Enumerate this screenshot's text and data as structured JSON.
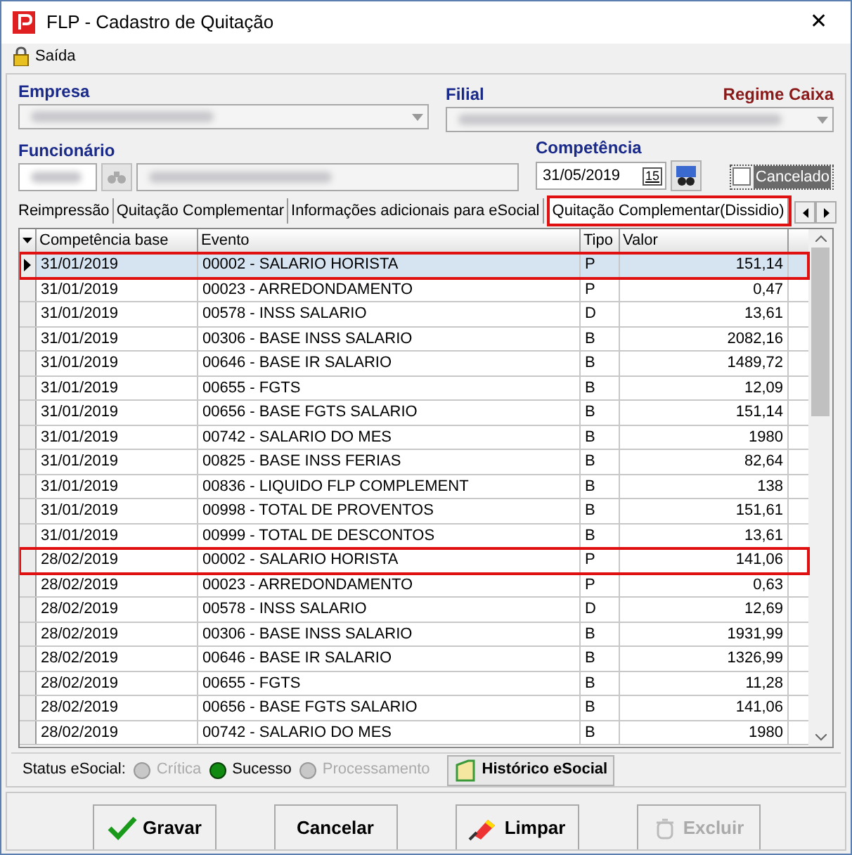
{
  "window": {
    "title": "FLP - Cadastro de Quitação",
    "close": "✕"
  },
  "menu": [
    {
      "label": "Saída"
    }
  ],
  "form": {
    "empresa_label": "Empresa",
    "filial_label": "Filial",
    "regime": "Regime Caixa",
    "funcionario_label": "Funcionário",
    "competencia_label": "Competência",
    "competencia_value": "31/05/2019",
    "calendar_day": "15",
    "cancelado": {
      "label": "Cancelado",
      "checked": false
    }
  },
  "tabs": [
    {
      "label": "Reimpressão",
      "selected": false,
      "highlighted": false
    },
    {
      "label": "Quitação Complementar",
      "selected": false,
      "highlighted": false
    },
    {
      "label": "Informações adicionais para eSocial",
      "selected": false,
      "highlighted": false
    },
    {
      "label": "Quitação Complementar(Dissidio)",
      "selected": true,
      "highlighted": true
    }
  ],
  "table": {
    "columns": [
      "Competência base",
      "Evento",
      "Tipo",
      "Valor"
    ],
    "rows": [
      {
        "cells": [
          "31/01/2019",
          "00002 - SALARIO HORISTA",
          "P",
          "151,14"
        ],
        "selected": true,
        "highlighted": true
      },
      {
        "cells": [
          "31/01/2019",
          "00023 - ARREDONDAMENTO",
          "P",
          "0,47"
        ],
        "selected": false,
        "highlighted": false
      },
      {
        "cells": [
          "31/01/2019",
          "00578 - INSS SALARIO",
          "D",
          "13,61"
        ],
        "selected": false,
        "highlighted": false
      },
      {
        "cells": [
          "31/01/2019",
          "00306 - BASE INSS SALARIO",
          "B",
          "2082,16"
        ],
        "selected": false,
        "highlighted": false
      },
      {
        "cells": [
          "31/01/2019",
          "00646 - BASE IR SALARIO",
          "B",
          "1489,72"
        ],
        "selected": false,
        "highlighted": false
      },
      {
        "cells": [
          "31/01/2019",
          "00655 - FGTS",
          "B",
          "12,09"
        ],
        "selected": false,
        "highlighted": false
      },
      {
        "cells": [
          "31/01/2019",
          "00656 - BASE FGTS SALARIO",
          "B",
          "151,14"
        ],
        "selected": false,
        "highlighted": false
      },
      {
        "cells": [
          "31/01/2019",
          "00742 - SALARIO DO MES",
          "B",
          "1980"
        ],
        "selected": false,
        "highlighted": false
      },
      {
        "cells": [
          "31/01/2019",
          "00825 - BASE INSS FERIAS",
          "B",
          "82,64"
        ],
        "selected": false,
        "highlighted": false
      },
      {
        "cells": [
          "31/01/2019",
          "00836 - LIQUIDO FLP COMPLEMENT",
          "B",
          "138"
        ],
        "selected": false,
        "highlighted": false
      },
      {
        "cells": [
          "31/01/2019",
          "00998 - TOTAL DE PROVENTOS",
          "B",
          "151,61"
        ],
        "selected": false,
        "highlighted": false
      },
      {
        "cells": [
          "31/01/2019",
          "00999 - TOTAL DE DESCONTOS",
          "B",
          "13,61"
        ],
        "selected": false,
        "highlighted": false
      },
      {
        "cells": [
          "28/02/2019",
          "00002 - SALARIO HORISTA",
          "P",
          "141,06"
        ],
        "selected": false,
        "highlighted": true
      },
      {
        "cells": [
          "28/02/2019",
          "00023 - ARREDONDAMENTO",
          "P",
          "0,63"
        ],
        "selected": false,
        "highlighted": false
      },
      {
        "cells": [
          "28/02/2019",
          "00578 - INSS SALARIO",
          "D",
          "12,69"
        ],
        "selected": false,
        "highlighted": false
      },
      {
        "cells": [
          "28/02/2019",
          "00306 - BASE INSS SALARIO",
          "B",
          "1931,99"
        ],
        "selected": false,
        "highlighted": false
      },
      {
        "cells": [
          "28/02/2019",
          "00646 - BASE IR SALARIO",
          "B",
          "1326,99"
        ],
        "selected": false,
        "highlighted": false
      },
      {
        "cells": [
          "28/02/2019",
          "00655 - FGTS",
          "B",
          "11,28"
        ],
        "selected": false,
        "highlighted": false
      },
      {
        "cells": [
          "28/02/2019",
          "00656 - BASE FGTS SALARIO",
          "B",
          "141,06"
        ],
        "selected": false,
        "highlighted": false
      },
      {
        "cells": [
          "28/02/2019",
          "00742 - SALARIO DO MES",
          "B",
          "1980"
        ],
        "selected": false,
        "highlighted": false
      }
    ]
  },
  "status": {
    "label": "Status eSocial:",
    "options": [
      {
        "label": "Crítica",
        "selected": false,
        "disabled": true
      },
      {
        "label": "Sucesso",
        "selected": true,
        "disabled": false
      },
      {
        "label": "Processamento",
        "selected": false,
        "disabled": true
      }
    ],
    "history_button": "Histórico eSocial"
  },
  "buttons": [
    {
      "label": "Gravar",
      "kind": "save",
      "disabled": false
    },
    {
      "label": "Cancelar",
      "kind": "cancel",
      "disabled": false
    },
    {
      "label": "Limpar",
      "kind": "clear",
      "disabled": false
    },
    {
      "label": "Excluir",
      "kind": "delete",
      "disabled": true
    }
  ]
}
